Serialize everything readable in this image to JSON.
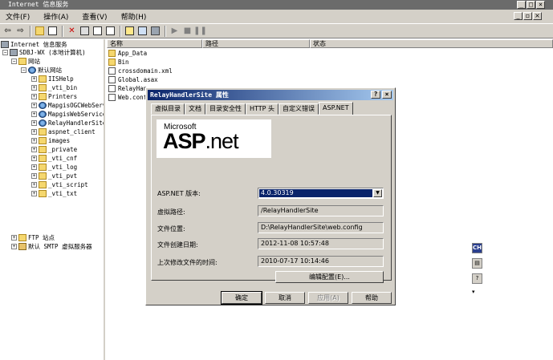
{
  "window": {
    "title": "Internet 信息服务"
  },
  "menu": [
    "文件(F)",
    "操作(A)",
    "查看(V)",
    "帮助(H)"
  ],
  "tree": {
    "root": "Internet 信息服务",
    "computer": "SDBJ-WX (本地计算机)",
    "websites": "网站",
    "default_site": "默认网站",
    "items": [
      "IISHelp",
      "_vti_bin",
      "Printers",
      "MapgisOGCWebServ",
      "MapgisWebService",
      "RelayHandlerSite",
      "aspnet_client",
      "images",
      "_private",
      "_vti_cnf",
      "_vti_log",
      "_vti_pvt",
      "_vti_script",
      "_vti_txt"
    ],
    "ftp": "FTP 站点",
    "smtp": "默认 SMTP 虚拟服务器"
  },
  "list": {
    "columns": [
      "名称",
      "路径",
      "状态"
    ],
    "rows": [
      "App_Data",
      "Bin",
      "crossdomain.xml",
      "Global.asax",
      "RelayHan...",
      "Web.conf..."
    ]
  },
  "dialog": {
    "title": "RelayHandlerSite 属性",
    "tabs": [
      "虚拟目录",
      "文档",
      "目录安全性",
      "HTTP 头",
      "自定义错误",
      "ASP.NET"
    ],
    "active_tab": "ASP.NET",
    "logo": {
      "brand": "Microsoft",
      "main": "ASP",
      "suffix": ".net"
    },
    "fields": {
      "version_label": "ASP.NET 版本:",
      "version_value": "4.0.30319",
      "vpath_label": "虚拟路径:",
      "vpath_value": "/RelayHandlerSite",
      "filepath_label": "文件位置:",
      "filepath_value": "D:\\RelayHandlerSite\\web.config",
      "created_label": "文件创建日期:",
      "created_value": "2012-11-08 10:57:48",
      "modified_label": "上次修改文件的时间:",
      "modified_value": "2010-07-17 10:14:46"
    },
    "edit_config_button": "编辑配置(E)...",
    "buttons": {
      "ok": "确定",
      "cancel": "取消",
      "apply": "应用(A)",
      "help": "帮助"
    }
  },
  "side_tools": {
    "ime": "CH"
  }
}
